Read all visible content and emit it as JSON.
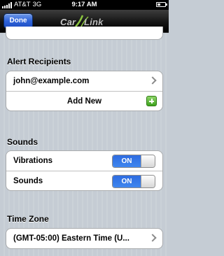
{
  "status_bar": {
    "carrier": "AT&T",
    "network": "3G",
    "time": "9:17 AM"
  },
  "nav": {
    "done_label": "Done",
    "logo_part1": "Car",
    "logo_part2": "Link"
  },
  "alert_recipients": {
    "title": "Alert Recipients",
    "email": "john@example.com",
    "add_new_label": "Add New"
  },
  "sounds": {
    "title": "Sounds",
    "items": [
      {
        "label": "Vibrations",
        "state": "ON"
      },
      {
        "label": "Sounds",
        "state": "ON"
      }
    ]
  },
  "time_zone": {
    "title": "Time Zone",
    "value": "(GMT-05:00) Eastern Time (U..."
  },
  "colors": {
    "accent_blue": "#3f86ef",
    "done_button": "#2f63d9",
    "add_icon_green": "#3da21d"
  }
}
